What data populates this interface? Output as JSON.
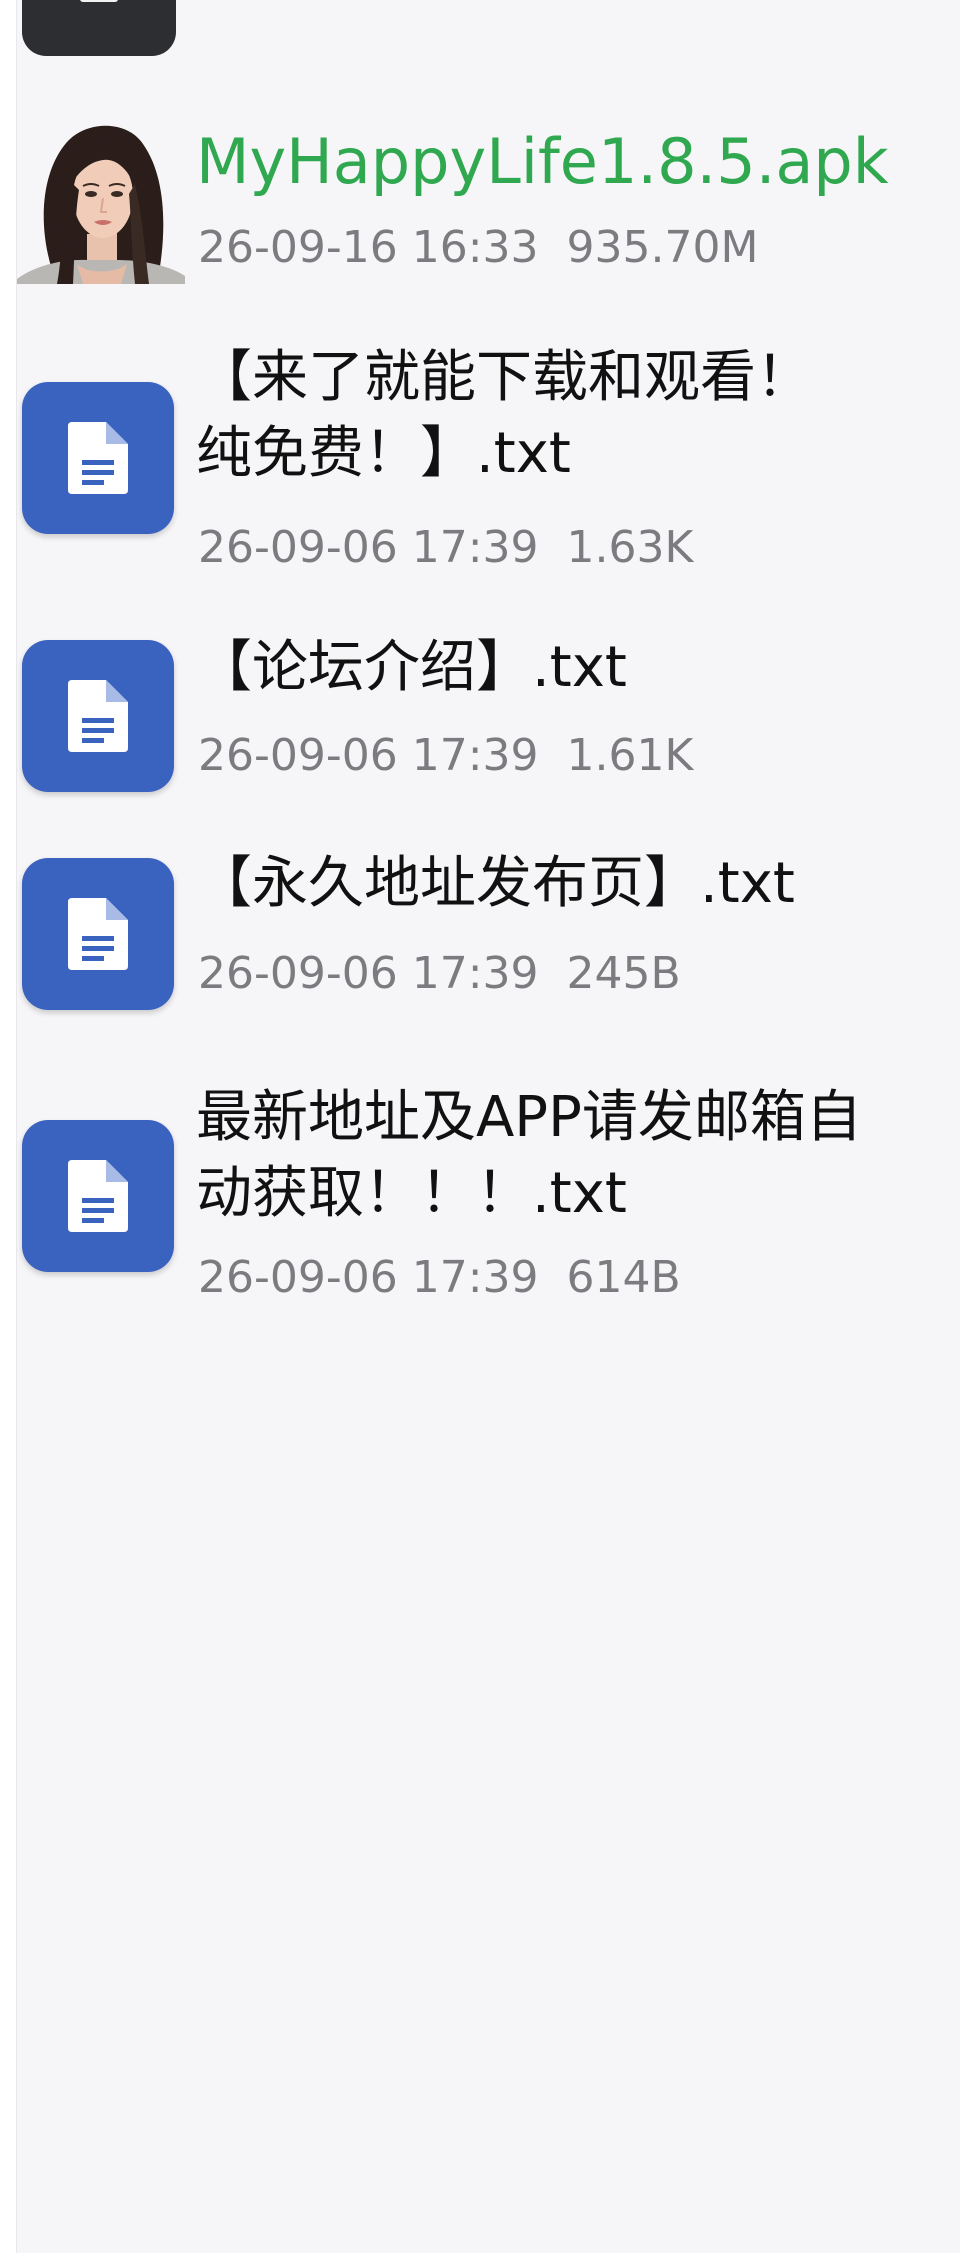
{
  "files": [
    {
      "name": "MyHappyLife1.8.5.apk",
      "date": "26-09-16 16:33",
      "size": "935.70M",
      "icon": "app-thumbnail-woman"
    },
    {
      "name": "【来了就能下载和观看！纯免费！】.txt",
      "date": "26-09-06 17:39",
      "size": "1.63K",
      "icon": "document-icon"
    },
    {
      "name": "【论坛介绍】.txt",
      "date": "26-09-06 17:39",
      "size": "1.61K",
      "icon": "document-icon"
    },
    {
      "name": "【永久地址发布页】.txt",
      "date": "26-09-06 17:39",
      "size": "245B",
      "icon": "document-icon"
    },
    {
      "name": "最新地址及APP请发邮箱自动获取！！！.txt",
      "date": "26-09-06 17:39",
      "size": "614B",
      "icon": "document-icon"
    }
  ],
  "colors": {
    "apk_name": "#2fa84f",
    "doc_icon_bg": "#3a63c0",
    "meta_text": "#7c7c80",
    "background": "#f6f6f8"
  }
}
